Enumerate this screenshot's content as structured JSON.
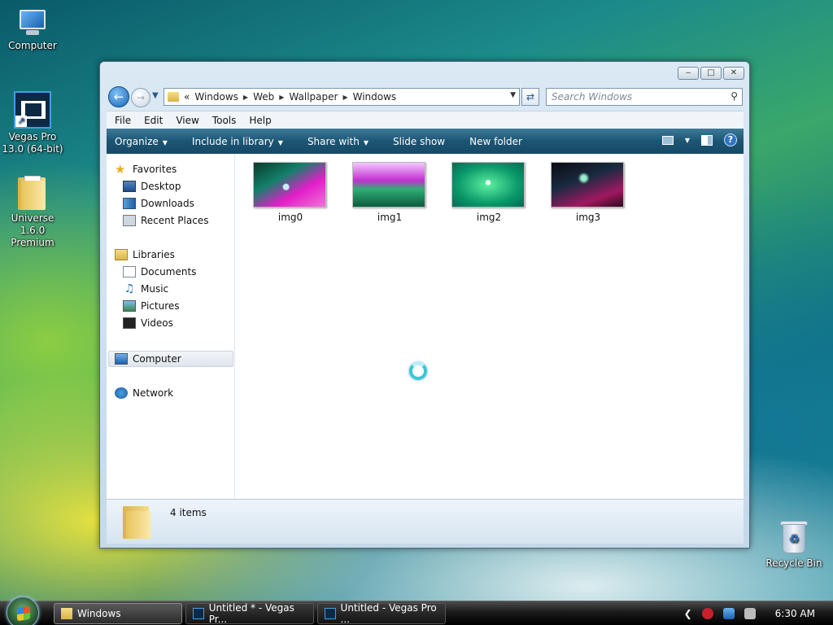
{
  "desktop": {
    "icons": [
      {
        "label": "Computer"
      },
      {
        "label": "Vegas Pro 13.0 (64-bit)"
      },
      {
        "label": "Universe 1.6.0 Premium"
      },
      {
        "label": "Recycle Bin"
      }
    ]
  },
  "window": {
    "caption": {
      "minimize": "‒",
      "maximize": "□",
      "close": "✕"
    },
    "address": {
      "overflow": "«",
      "crumbs": [
        "Windows",
        "Web",
        "Wallpaper",
        "Windows"
      ]
    },
    "search": {
      "placeholder": "Search Windows"
    },
    "menu": [
      "File",
      "Edit",
      "View",
      "Tools",
      "Help"
    ],
    "commands": [
      "Organize",
      "Include in library",
      "Share with",
      "Slide show",
      "New folder"
    ],
    "help_label": "?",
    "nav": {
      "favorites": "Favorites",
      "favorites_items": [
        "Desktop",
        "Downloads",
        "Recent Places"
      ],
      "libraries": "Libraries",
      "libraries_items": [
        "Documents",
        "Music",
        "Pictures",
        "Videos"
      ],
      "computer": "Computer",
      "network": "Network"
    },
    "files": [
      {
        "name": "img0"
      },
      {
        "name": "img1"
      },
      {
        "name": "img2"
      },
      {
        "name": "img3"
      }
    ],
    "details": {
      "count": "4 items"
    }
  },
  "taskbar": {
    "buttons": [
      "Windows",
      "Untitled * - Vegas Pr...",
      "Untitled - Vegas Pro ..."
    ],
    "clock": "6:30 AM"
  }
}
